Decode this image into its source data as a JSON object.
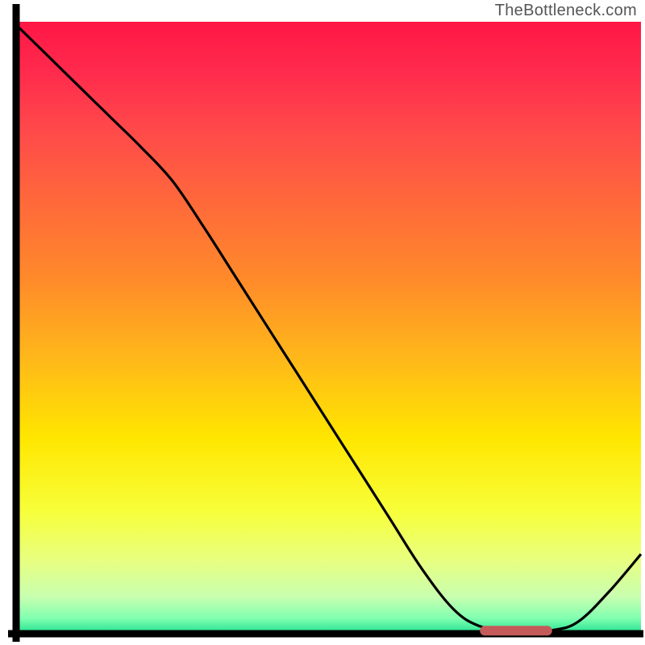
{
  "watermark": "TheBottleneck.com",
  "chart_data": {
    "type": "line",
    "title": "",
    "xlabel": "",
    "ylabel": "",
    "xlim": [
      0,
      100
    ],
    "ylim": [
      0,
      100
    ],
    "x": [
      0,
      5,
      10,
      15,
      20,
      25,
      30,
      35,
      40,
      45,
      50,
      55,
      60,
      65,
      70,
      74,
      78,
      82,
      86,
      90,
      95,
      100
    ],
    "values": [
      99.5,
      94.5,
      89.5,
      84.5,
      79.5,
      74.0,
      66.5,
      58.5,
      50.5,
      42.5,
      34.5,
      26.5,
      18.5,
      10.5,
      4.0,
      1.3,
      0.6,
      0.5,
      0.6,
      2.0,
      7.0,
      13.0
    ],
    "marker": {
      "x_start": 75,
      "x_end": 85,
      "y": 0.5,
      "color": "#c55a5a"
    },
    "gradient_stops": [
      {
        "offset": 0.0,
        "color": "#ff1744"
      },
      {
        "offset": 0.08,
        "color": "#ff2a4d"
      },
      {
        "offset": 0.18,
        "color": "#ff4a4a"
      },
      {
        "offset": 0.3,
        "color": "#ff6a3a"
      },
      {
        "offset": 0.42,
        "color": "#ff8a2a"
      },
      {
        "offset": 0.55,
        "color": "#ffb81a"
      },
      {
        "offset": 0.68,
        "color": "#ffe600"
      },
      {
        "offset": 0.8,
        "color": "#f7ff3a"
      },
      {
        "offset": 0.88,
        "color": "#e8ff80"
      },
      {
        "offset": 0.94,
        "color": "#c8ffb0"
      },
      {
        "offset": 0.975,
        "color": "#80ffb0"
      },
      {
        "offset": 1.0,
        "color": "#20e090"
      }
    ],
    "axis_color": "#000000",
    "line_color": "#000000"
  }
}
